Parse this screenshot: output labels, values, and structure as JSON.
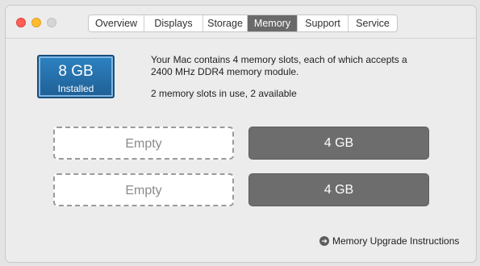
{
  "tabs": [
    {
      "label": "Overview",
      "active": false
    },
    {
      "label": "Displays",
      "active": false
    },
    {
      "label": "Storage",
      "active": false
    },
    {
      "label": "Memory",
      "active": true
    },
    {
      "label": "Support",
      "active": false
    },
    {
      "label": "Service",
      "active": false
    }
  ],
  "summary": {
    "size": "8 GB",
    "label": "Installed",
    "color": "#2d82c1"
  },
  "description": {
    "text": "Your Mac contains 4 memory slots, each of which accepts a 2400 MHz DDR4 memory module.",
    "status": "2 memory slots in use, 2 available"
  },
  "slots": [
    {
      "label": "Empty",
      "state": "empty"
    },
    {
      "label": "4 GB",
      "state": "filled"
    },
    {
      "label": "Empty",
      "state": "empty"
    },
    {
      "label": "4 GB",
      "state": "filled"
    }
  ],
  "upgrade_link": {
    "icon": "arrow-right-circle-icon",
    "label": "Memory Upgrade Instructions"
  }
}
